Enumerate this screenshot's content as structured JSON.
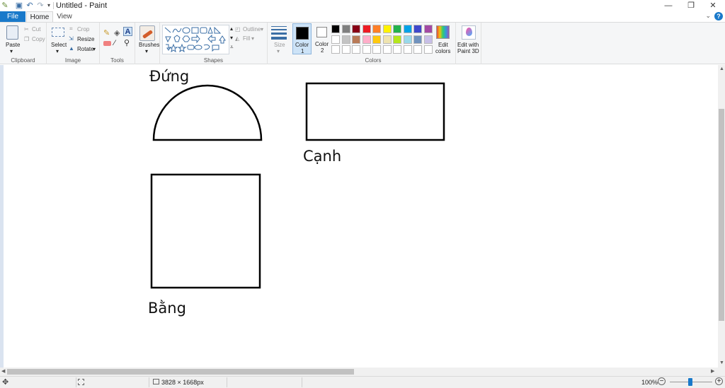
{
  "window": {
    "title": "Untitled - Paint",
    "quick_access": [
      "save-icon",
      "undo-icon",
      "redo-icon",
      "customize-icon"
    ],
    "buttons": {
      "minimize": "—",
      "restore": "❐",
      "close": "✕"
    }
  },
  "tabs": {
    "file": "File",
    "home": "Home",
    "view": "View",
    "help": "?"
  },
  "ribbon": {
    "clipboard": {
      "paste": "Paste",
      "cut": "Cut",
      "copy": "Copy",
      "label": "Clipboard"
    },
    "image": {
      "select": "Select",
      "crop": "Crop",
      "resize": "Resize",
      "rotate": "Rotate",
      "label": "Image"
    },
    "tools": {
      "label": "Tools"
    },
    "brushes": {
      "label": "Brushes"
    },
    "shapes": {
      "outline": "Outline",
      "fill": "Fill",
      "label": "Shapes"
    },
    "size": {
      "label": "Size"
    },
    "colors": {
      "color1_label": "Color",
      "color1_num": "1",
      "color2_label": "Color",
      "color2_num": "2",
      "edit_colors_line1": "Edit",
      "edit_colors_line2": "colors",
      "edit_paint3d_line1": "Edit with",
      "edit_paint3d_line2": "Paint 3D",
      "label": "Colors",
      "color1": "#000000",
      "color2": "#ffffff",
      "palette_row1": [
        "#000000",
        "#7f7f7f",
        "#880015",
        "#ed1c24",
        "#ff7f27",
        "#fff200",
        "#22b14c",
        "#00a2e8",
        "#3f48cc",
        "#a349a4"
      ],
      "palette_row2": [
        "#ffffff",
        "#c3c3c3",
        "#b97a57",
        "#ffaec9",
        "#ffc90e",
        "#efe4b0",
        "#b5e61d",
        "#99d9ea",
        "#7092be",
        "#c8bfe7"
      ],
      "palette_row3": [
        "#ffffff",
        "#ffffff",
        "#ffffff",
        "#ffffff",
        "#ffffff",
        "#ffffff",
        "#ffffff",
        "#ffffff",
        "#ffffff",
        "#ffffff"
      ]
    }
  },
  "canvas": {
    "labels": {
      "semicircle": "Đứng",
      "rectangle": "Cạnh",
      "square": "Bằng"
    }
  },
  "status": {
    "dimensions": "3828 × 1668px",
    "zoom": "100%"
  }
}
